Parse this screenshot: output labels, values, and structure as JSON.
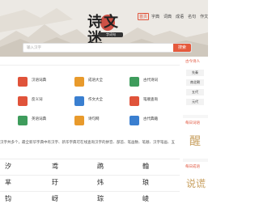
{
  "brand": {
    "logo_text": "诗文迷",
    "logo_sub": "字词句"
  },
  "nav": {
    "items": [
      {
        "label": "首页",
        "active": true
      },
      {
        "label": "字典",
        "active": false
      },
      {
        "label": "词典",
        "active": false
      },
      {
        "label": "成语",
        "active": false
      },
      {
        "label": "名句",
        "active": false
      },
      {
        "label": "作文",
        "active": false
      },
      {
        "label": "诗词",
        "active": false
      }
    ]
  },
  "search": {
    "placeholder": "输入汉字",
    "button_label": "搜索"
  },
  "tools": [
    {
      "label": "汉语词典",
      "icon": "dictionary-icon",
      "color": "#e0533a"
    },
    {
      "label": "成语大全",
      "icon": "idiom-icon",
      "color": "#e89a2c"
    },
    {
      "label": "古代诗词",
      "icon": "poetry-icon",
      "color": "#3e9c5c"
    },
    {
      "label": "反义词",
      "icon": "antonym-icon",
      "color": "#e0533a"
    },
    {
      "label": "作文大全",
      "icon": "essay-icon",
      "color": "#3a7fd0"
    },
    {
      "label": "笔顺查询",
      "icon": "stroke-order-icon",
      "color": "#e0533a"
    },
    {
      "label": "英语词典",
      "icon": "english-dict-icon",
      "color": "#3e9c5c"
    },
    {
      "label": "诗句网",
      "icon": "verse-icon",
      "color": "#e89a2c"
    },
    {
      "label": "古代典籍",
      "icon": "classics-icon",
      "color": "#3a7fd0"
    }
  ],
  "description": "汉字共多个，最全新华字典中有汉字、新华字典可在线查询汉字的拼音、部首、笔画数、笔顺、汉字笔画、五",
  "sidebar": {
    "hot_title": "古今诗人",
    "tags": [
      "先秦",
      "南北朝",
      "五代",
      "元代"
    ],
    "daily_word_title": "每日词语",
    "daily_word_char": "醒",
    "daily_idiom_title": "每日成语",
    "daily_idiom_char": "说谎"
  },
  "char_grid": [
    [
      "汐",
      "鸢",
      "鹉",
      "翰"
    ],
    [
      "芈",
      "玗",
      "炜",
      "琅"
    ],
    [
      "钧",
      "岈",
      "琮",
      "崚"
    ]
  ]
}
